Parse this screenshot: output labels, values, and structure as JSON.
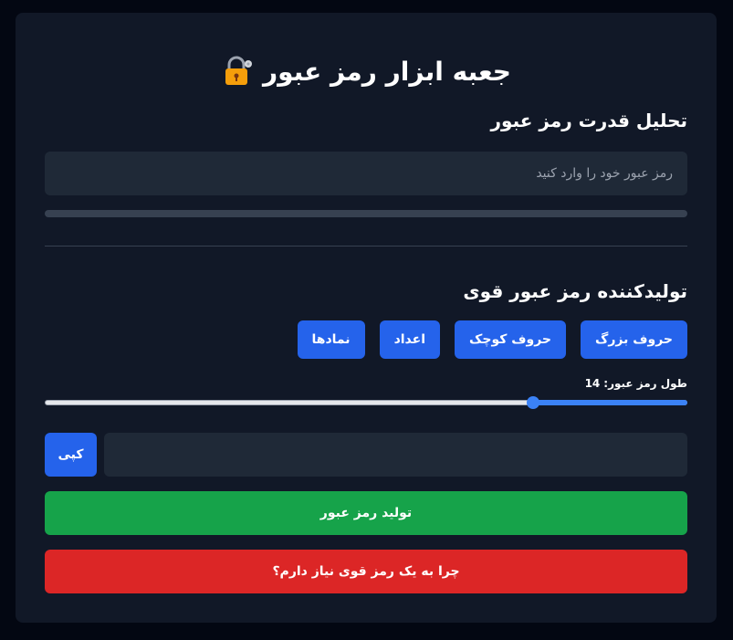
{
  "header": {
    "title": "جعبه ابزار رمز عبور",
    "icon": "lock-with-key-icon"
  },
  "analysis": {
    "heading": "تحلیل قدرت رمز عبور",
    "input_value": "",
    "input_placeholder": "رمز عبور خود را وارد کنید",
    "strength": 0
  },
  "generator": {
    "heading": "تولیدکننده رمز عبور قوی",
    "options": [
      "حروف بزرگ",
      "حروف کوچک",
      "اعداد",
      "نمادها"
    ],
    "length_label": "طول رمز عبور:",
    "length_value": "14",
    "length_fraction": 0.24,
    "output_value": "",
    "copy_label": "کپی",
    "generate_label": "تولید رمز عبور",
    "why_label": "چرا به یک رمز قوی نیاز دارم؟"
  },
  "colors": {
    "background": "#030712",
    "card": "#111827",
    "primary": "#2563eb",
    "success": "#16a34a",
    "danger": "#dc2626"
  }
}
